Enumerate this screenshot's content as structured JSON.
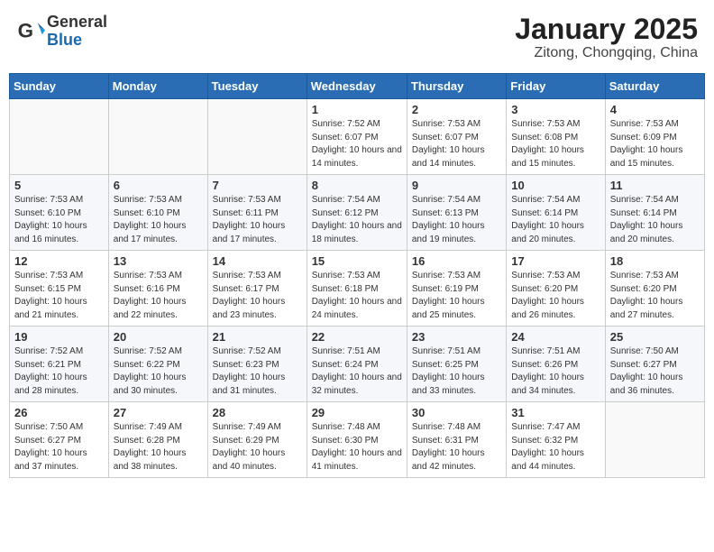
{
  "header": {
    "logo_general": "General",
    "logo_blue": "Blue",
    "month_title": "January 2025",
    "location": "Zitong, Chongqing, China"
  },
  "days_of_week": [
    "Sunday",
    "Monday",
    "Tuesday",
    "Wednesday",
    "Thursday",
    "Friday",
    "Saturday"
  ],
  "weeks": [
    [
      {
        "day": "",
        "info": ""
      },
      {
        "day": "",
        "info": ""
      },
      {
        "day": "",
        "info": ""
      },
      {
        "day": "1",
        "info": "Sunrise: 7:52 AM\nSunset: 6:07 PM\nDaylight: 10 hours and 14 minutes."
      },
      {
        "day": "2",
        "info": "Sunrise: 7:53 AM\nSunset: 6:07 PM\nDaylight: 10 hours and 14 minutes."
      },
      {
        "day": "3",
        "info": "Sunrise: 7:53 AM\nSunset: 6:08 PM\nDaylight: 10 hours and 15 minutes."
      },
      {
        "day": "4",
        "info": "Sunrise: 7:53 AM\nSunset: 6:09 PM\nDaylight: 10 hours and 15 minutes."
      }
    ],
    [
      {
        "day": "5",
        "info": "Sunrise: 7:53 AM\nSunset: 6:10 PM\nDaylight: 10 hours and 16 minutes."
      },
      {
        "day": "6",
        "info": "Sunrise: 7:53 AM\nSunset: 6:10 PM\nDaylight: 10 hours and 17 minutes."
      },
      {
        "day": "7",
        "info": "Sunrise: 7:53 AM\nSunset: 6:11 PM\nDaylight: 10 hours and 17 minutes."
      },
      {
        "day": "8",
        "info": "Sunrise: 7:54 AM\nSunset: 6:12 PM\nDaylight: 10 hours and 18 minutes."
      },
      {
        "day": "9",
        "info": "Sunrise: 7:54 AM\nSunset: 6:13 PM\nDaylight: 10 hours and 19 minutes."
      },
      {
        "day": "10",
        "info": "Sunrise: 7:54 AM\nSunset: 6:14 PM\nDaylight: 10 hours and 20 minutes."
      },
      {
        "day": "11",
        "info": "Sunrise: 7:54 AM\nSunset: 6:14 PM\nDaylight: 10 hours and 20 minutes."
      }
    ],
    [
      {
        "day": "12",
        "info": "Sunrise: 7:53 AM\nSunset: 6:15 PM\nDaylight: 10 hours and 21 minutes."
      },
      {
        "day": "13",
        "info": "Sunrise: 7:53 AM\nSunset: 6:16 PM\nDaylight: 10 hours and 22 minutes."
      },
      {
        "day": "14",
        "info": "Sunrise: 7:53 AM\nSunset: 6:17 PM\nDaylight: 10 hours and 23 minutes."
      },
      {
        "day": "15",
        "info": "Sunrise: 7:53 AM\nSunset: 6:18 PM\nDaylight: 10 hours and 24 minutes."
      },
      {
        "day": "16",
        "info": "Sunrise: 7:53 AM\nSunset: 6:19 PM\nDaylight: 10 hours and 25 minutes."
      },
      {
        "day": "17",
        "info": "Sunrise: 7:53 AM\nSunset: 6:20 PM\nDaylight: 10 hours and 26 minutes."
      },
      {
        "day": "18",
        "info": "Sunrise: 7:53 AM\nSunset: 6:20 PM\nDaylight: 10 hours and 27 minutes."
      }
    ],
    [
      {
        "day": "19",
        "info": "Sunrise: 7:52 AM\nSunset: 6:21 PM\nDaylight: 10 hours and 28 minutes."
      },
      {
        "day": "20",
        "info": "Sunrise: 7:52 AM\nSunset: 6:22 PM\nDaylight: 10 hours and 30 minutes."
      },
      {
        "day": "21",
        "info": "Sunrise: 7:52 AM\nSunset: 6:23 PM\nDaylight: 10 hours and 31 minutes."
      },
      {
        "day": "22",
        "info": "Sunrise: 7:51 AM\nSunset: 6:24 PM\nDaylight: 10 hours and 32 minutes."
      },
      {
        "day": "23",
        "info": "Sunrise: 7:51 AM\nSunset: 6:25 PM\nDaylight: 10 hours and 33 minutes."
      },
      {
        "day": "24",
        "info": "Sunrise: 7:51 AM\nSunset: 6:26 PM\nDaylight: 10 hours and 34 minutes."
      },
      {
        "day": "25",
        "info": "Sunrise: 7:50 AM\nSunset: 6:27 PM\nDaylight: 10 hours and 36 minutes."
      }
    ],
    [
      {
        "day": "26",
        "info": "Sunrise: 7:50 AM\nSunset: 6:27 PM\nDaylight: 10 hours and 37 minutes."
      },
      {
        "day": "27",
        "info": "Sunrise: 7:49 AM\nSunset: 6:28 PM\nDaylight: 10 hours and 38 minutes."
      },
      {
        "day": "28",
        "info": "Sunrise: 7:49 AM\nSunset: 6:29 PM\nDaylight: 10 hours and 40 minutes."
      },
      {
        "day": "29",
        "info": "Sunrise: 7:48 AM\nSunset: 6:30 PM\nDaylight: 10 hours and 41 minutes."
      },
      {
        "day": "30",
        "info": "Sunrise: 7:48 AM\nSunset: 6:31 PM\nDaylight: 10 hours and 42 minutes."
      },
      {
        "day": "31",
        "info": "Sunrise: 7:47 AM\nSunset: 6:32 PM\nDaylight: 10 hours and 44 minutes."
      },
      {
        "day": "",
        "info": ""
      }
    ]
  ]
}
